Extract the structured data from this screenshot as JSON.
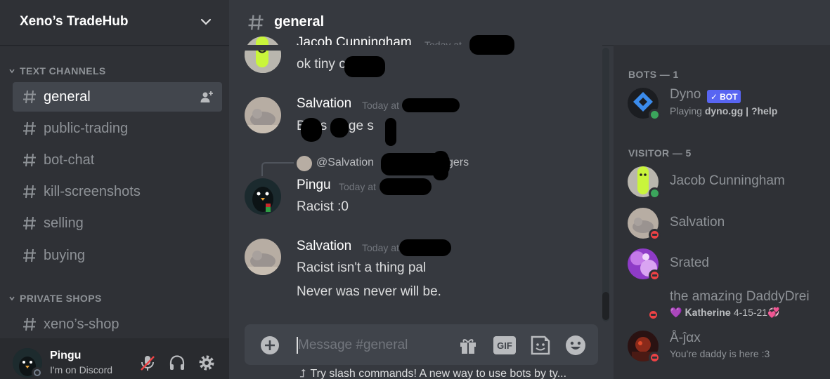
{
  "server": {
    "name": "Xeno’s TradeHub"
  },
  "categories": [
    {
      "label": "TEXT CHANNELS"
    },
    {
      "label": "PRIVATE SHOPS"
    }
  ],
  "channels": [
    {
      "name": "general",
      "active": true
    },
    {
      "name": "public-trading"
    },
    {
      "name": "bot-chat"
    },
    {
      "name": "kill-screenshots"
    },
    {
      "name": "selling"
    },
    {
      "name": "buying"
    },
    {
      "name": "xeno’s-shop"
    }
  ],
  "current_channel": {
    "name": "general"
  },
  "user": {
    "name": "Pingu",
    "status": "I'm on Discord"
  },
  "messages": [
    {
      "author": "Jacob Cunningham",
      "timestamp": "Today at",
      "lines": [
        "ok tiny c"
      ]
    },
    {
      "author": "Salvation",
      "timestamp": "Today at",
      "lines": [
        "B   h   s nigge s"
      ]
    },
    {
      "reply_to": "@Salvation",
      "reply_snippet": "gers",
      "author": "Pingu",
      "timestamp": "Today at",
      "lines": [
        "Racist :0"
      ]
    },
    {
      "author": "Salvation",
      "timestamp": "Today at",
      "lines": [
        "Racist isn't a thing pal",
        "Never was never will be."
      ]
    }
  ],
  "input": {
    "placeholder": "Message #general",
    "hint": "Try slash commands! A new way to use bots by ty..."
  },
  "input_icons": [
    "gift-icon",
    "gif-icon",
    "sticker-icon",
    "emoji-icon"
  ],
  "gif_label": "GIF",
  "member_groups": [
    {
      "label": "BOTS — 1"
    },
    {
      "label": "VISITOR — 5"
    }
  ],
  "members": [
    {
      "name": "Dyno",
      "badge": "BOT",
      "sub_prefix": "Playing ",
      "sub_bold": "dyno.gg | ?help",
      "status": "online"
    },
    {
      "name": "Jacob Cunningham",
      "status": "online"
    },
    {
      "name": "Salvation",
      "status": "dnd"
    },
    {
      "name": "Srated",
      "status": "dnd"
    },
    {
      "name": "the amazing DaddyDrei",
      "sub": "💜 𝐊𝐚𝐭𝐡𝐞𝐫𝐢𝐧𝐞 4-15-21💞",
      "status": "dnd"
    },
    {
      "name": "Å-ĵαx",
      "sub": "You're daddy is here :3",
      "status": "dnd"
    }
  ],
  "colors": {
    "accent": "#5865f2",
    "online": "#3ba55c",
    "dnd": "#ed4245"
  }
}
